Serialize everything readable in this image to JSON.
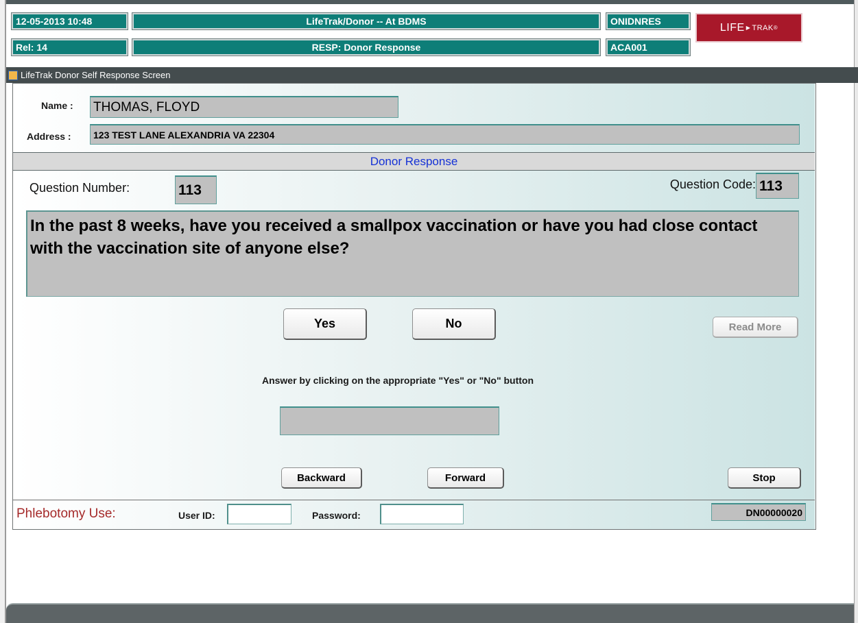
{
  "header": {
    "datetime": "12-05-2013  10:48",
    "release": "Rel: 14",
    "app_title": "LifeTrak/Donor -- At BDMS",
    "screen_title": "RESP: Donor Response",
    "code1": "ONIDNRES",
    "code2": "ACA001",
    "logo_text": "LIFE",
    "logo_arrow": "▶",
    "logo_small": "TRAK",
    "logo_reg": "®"
  },
  "window": {
    "title": "LifeTrak Donor Self Response Screen",
    "icon": "window-app-icon"
  },
  "donor": {
    "name_label": "Name :",
    "name_value": "THOMAS, FLOYD",
    "address_label": "Address :",
    "address_value": "123 TEST LANE  ALEXANDRIA VA 22304"
  },
  "section": {
    "title": "Donor Response"
  },
  "question": {
    "number_label": "Question Number:",
    "number_value": "113",
    "code_label": "Question Code:",
    "code_value": "113",
    "text": "In the past 8 weeks, have you received a smallpox vaccination or have you had close contact with the vaccination site of anyone else?"
  },
  "buttons": {
    "yes": "Yes",
    "no": "No",
    "read_more": "Read More",
    "backward": "Backward",
    "forward": "Forward",
    "stop": "Stop"
  },
  "instruction": "Answer by clicking on the appropriate \"Yes\"  or  \"No\" button",
  "answer_value": "",
  "phlebotomy": {
    "label": "Phlebotomy Use:",
    "user_label": "User ID:",
    "user_value": "",
    "password_label": "Password:",
    "password_value": "",
    "record_id": "DN00000020"
  },
  "colors": {
    "header_teal": "#0e7e78",
    "logo_red": "#a8182a",
    "section_blue": "#1531d6",
    "phlebotomy_red": "#a52a2a"
  }
}
